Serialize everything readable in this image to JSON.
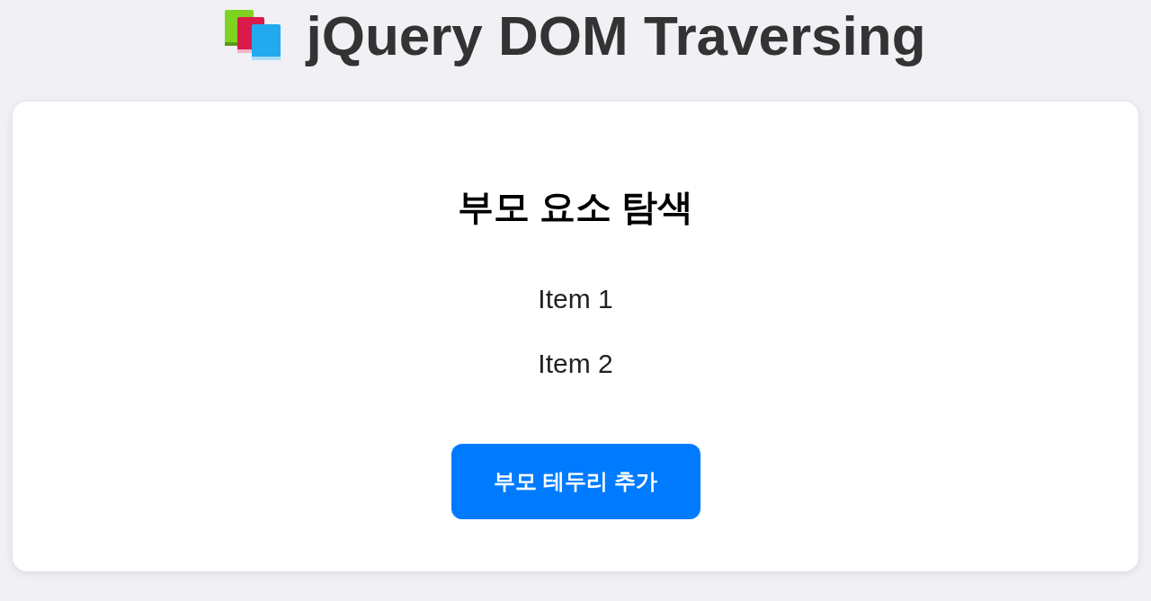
{
  "header": {
    "title": "jQuery DOM Traversing"
  },
  "card": {
    "heading": "부모 요소 탐색",
    "items": [
      "Item 1",
      "Item 2"
    ],
    "button": "부모 테두리 추가"
  }
}
